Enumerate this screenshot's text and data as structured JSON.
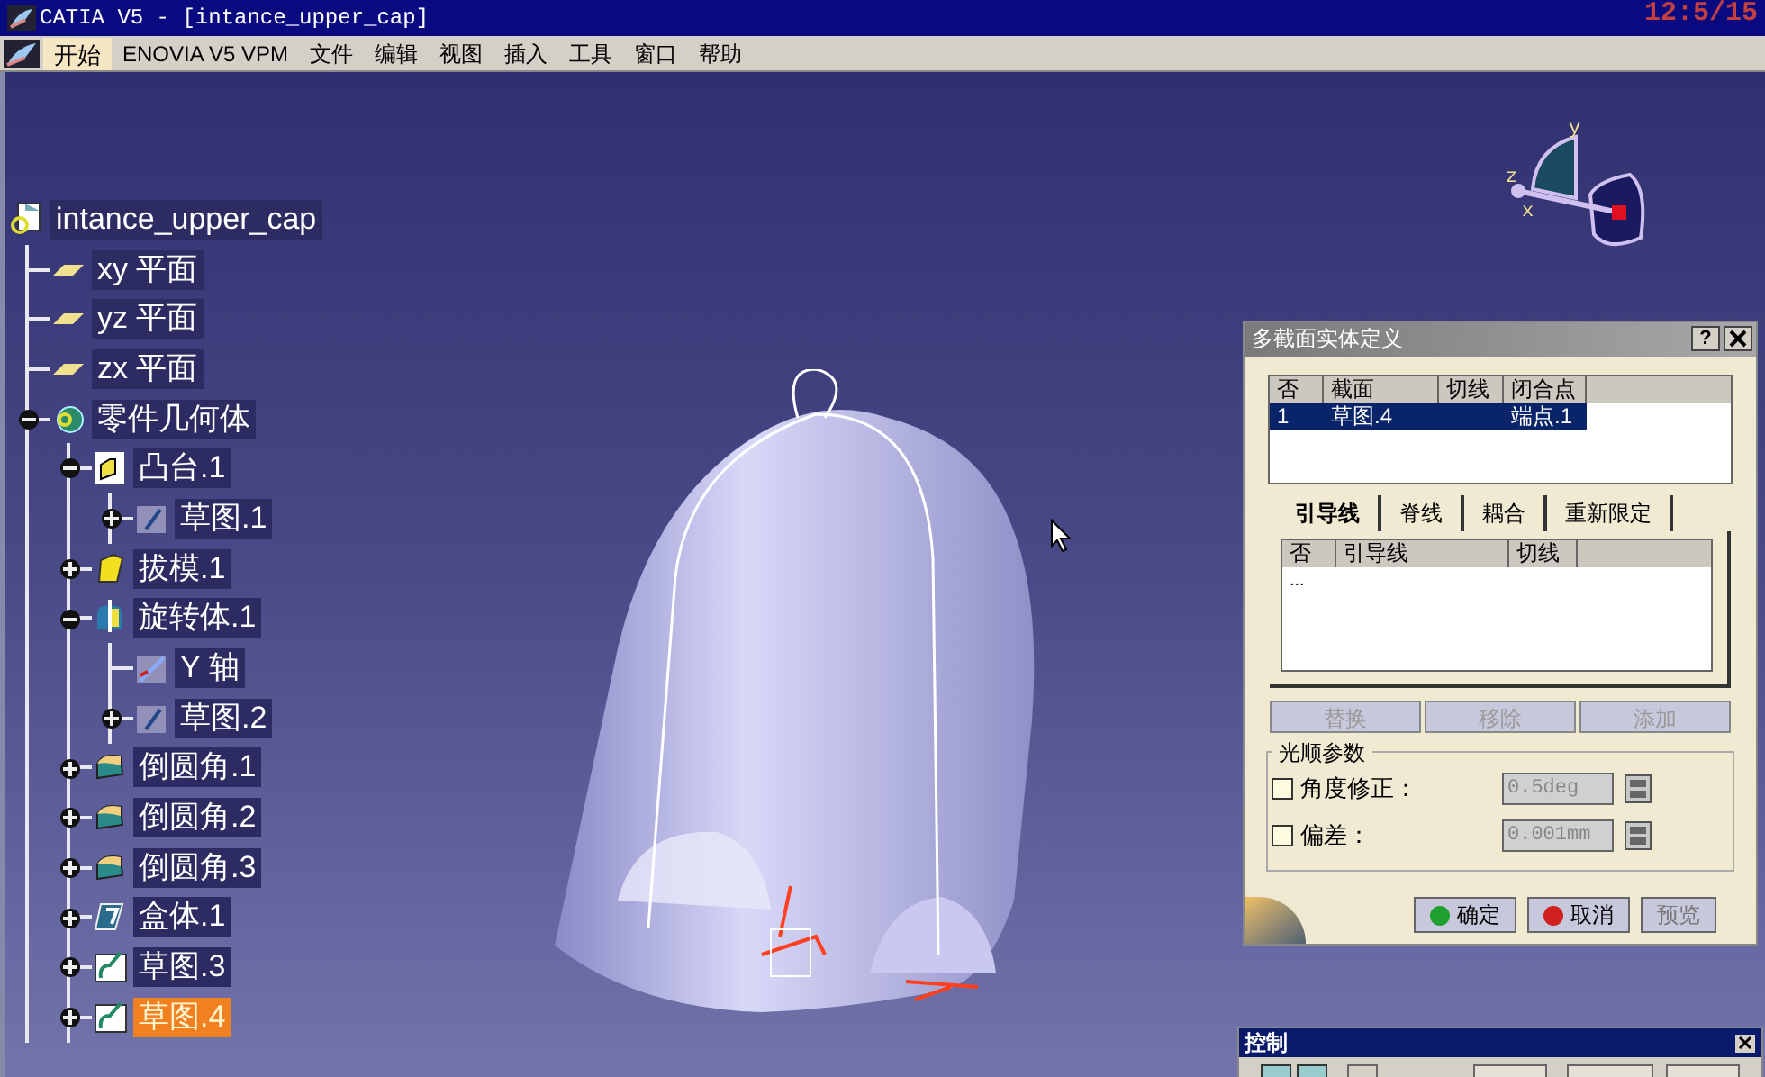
{
  "window": {
    "title": "CATIA V5 - [intance_upper_cap]",
    "clock": "12:5/15"
  },
  "menu": [
    {
      "label": "开始",
      "selected": true
    },
    {
      "label": "ENOVIA V5 VPM",
      "selected": false
    },
    {
      "label": "文件",
      "selected": false
    },
    {
      "label": "编辑",
      "selected": false
    },
    {
      "label": "视图",
      "selected": false
    },
    {
      "label": "插入",
      "selected": false
    },
    {
      "label": "工具",
      "selected": false
    },
    {
      "label": "窗口",
      "selected": false
    },
    {
      "label": "帮助",
      "selected": false
    }
  ],
  "tree": {
    "label": "intance_upper_cap",
    "kind": "file",
    "selected": false,
    "children": [
      {
        "label": "xy 平面",
        "kind": "plane",
        "selected": false
      },
      {
        "label": "yz 平面",
        "kind": "plane",
        "selected": false
      },
      {
        "label": "zx 平面",
        "kind": "plane",
        "selected": false
      },
      {
        "label": "零件几何体",
        "kind": "body",
        "selected": false,
        "expanded": true,
        "children": [
          {
            "label": "凸台.1",
            "kind": "pad",
            "selected": false,
            "expanded": true,
            "children": [
              {
                "label": "草图.1",
                "kind": "sketch",
                "selected": false,
                "expanded": false
              }
            ]
          },
          {
            "label": "拔模.1",
            "kind": "draft",
            "selected": false,
            "expanded": false
          },
          {
            "label": "旋转体.1",
            "kind": "revolve",
            "selected": false,
            "expanded": true,
            "children": [
              {
                "label": "Y 轴",
                "kind": "axis",
                "selected": false
              },
              {
                "label": "草图.2",
                "kind": "sketch",
                "selected": false,
                "expanded": false
              }
            ]
          },
          {
            "label": "倒圆角.1",
            "kind": "fillet",
            "selected": false,
            "expanded": false
          },
          {
            "label": "倒圆角.2",
            "kind": "fillet",
            "selected": false,
            "expanded": false
          },
          {
            "label": "倒圆角.3",
            "kind": "fillet",
            "selected": false,
            "expanded": false
          },
          {
            "label": "盒体.1",
            "kind": "shell",
            "selected": false,
            "expanded": false
          },
          {
            "label": "草图.3",
            "kind": "profile",
            "selected": false,
            "expanded": false
          },
          {
            "label": "草图.4",
            "kind": "profile",
            "selected": true,
            "expanded": false
          }
        ]
      }
    ]
  },
  "compass": {
    "labels": [
      "y",
      "z",
      "x"
    ]
  },
  "dialog": {
    "title": "多截面实体定义",
    "help": "?",
    "sections_table": {
      "columns": [
        "否",
        "截面",
        "切线",
        "闭合点"
      ],
      "rows": [
        {
          "no": "1",
          "section": "草图.4",
          "closing_point": "端点.1",
          "selected": true
        }
      ]
    },
    "tabs": [
      {
        "label": "引导线",
        "selected": true
      },
      {
        "label": "脊线",
        "selected": false
      },
      {
        "label": "耦合",
        "selected": false
      },
      {
        "label": "重新限定",
        "selected": false
      }
    ],
    "guides_table": {
      "columns": [
        "否",
        "引导线",
        "切线"
      ],
      "rows": [
        {
          "no": "..."
        }
      ]
    },
    "list_buttons": [
      {
        "label": "替换",
        "disabled": true
      },
      {
        "label": "移除",
        "disabled": true
      },
      {
        "label": "添加",
        "disabled": true
      }
    ],
    "smoothing": {
      "title": "光顺参数",
      "options": [
        {
          "label": "角度修正：",
          "checked": false,
          "value": "0.5deg",
          "disabled": true
        },
        {
          "label": "偏差：",
          "checked": false,
          "value": "0.001mm",
          "disabled": true
        }
      ]
    },
    "buttons": [
      {
        "label": "确定",
        "kind": "ok"
      },
      {
        "label": "取消",
        "kind": "cancel"
      },
      {
        "label": "预览",
        "kind": "preview"
      }
    ]
  },
  "control_toolbar": {
    "title": "控制"
  }
}
